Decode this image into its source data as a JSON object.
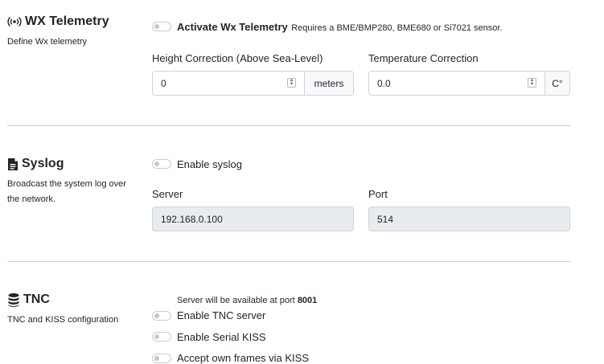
{
  "wx": {
    "title": "WX Telemetry",
    "description": "Define Wx telemetry",
    "toggle_label": "Activate Wx Telemetry",
    "toggle_hint": "Requires a BME/BMP280, BME680 or Si7021 sensor.",
    "height_label": "Height Correction (Above Sea-Level)",
    "height_value": "0",
    "height_unit": "meters",
    "temp_label": "Temperature Correction",
    "temp_value": "0.0",
    "temp_unit": "C°"
  },
  "syslog": {
    "title": "Syslog",
    "description": "Broadcast the system log over the network.",
    "toggle_label": "Enable syslog",
    "server_label": "Server",
    "server_value": "192.168.0.100",
    "port_label": "Port",
    "port_value": "514"
  },
  "tnc": {
    "title": "TNC",
    "description": "TNC and KISS configuration",
    "server_hint_prefix": "Server will be available at port",
    "server_hint_port": "8001",
    "server_toggle_label": "Enable TNC server",
    "serial_toggle_label": "Enable Serial KISS",
    "own_frames_label": "Accept own frames via KISS"
  },
  "icons": {
    "wx": "broadcast-icon",
    "syslog": "file-text-icon",
    "tnc": "database-icon"
  }
}
